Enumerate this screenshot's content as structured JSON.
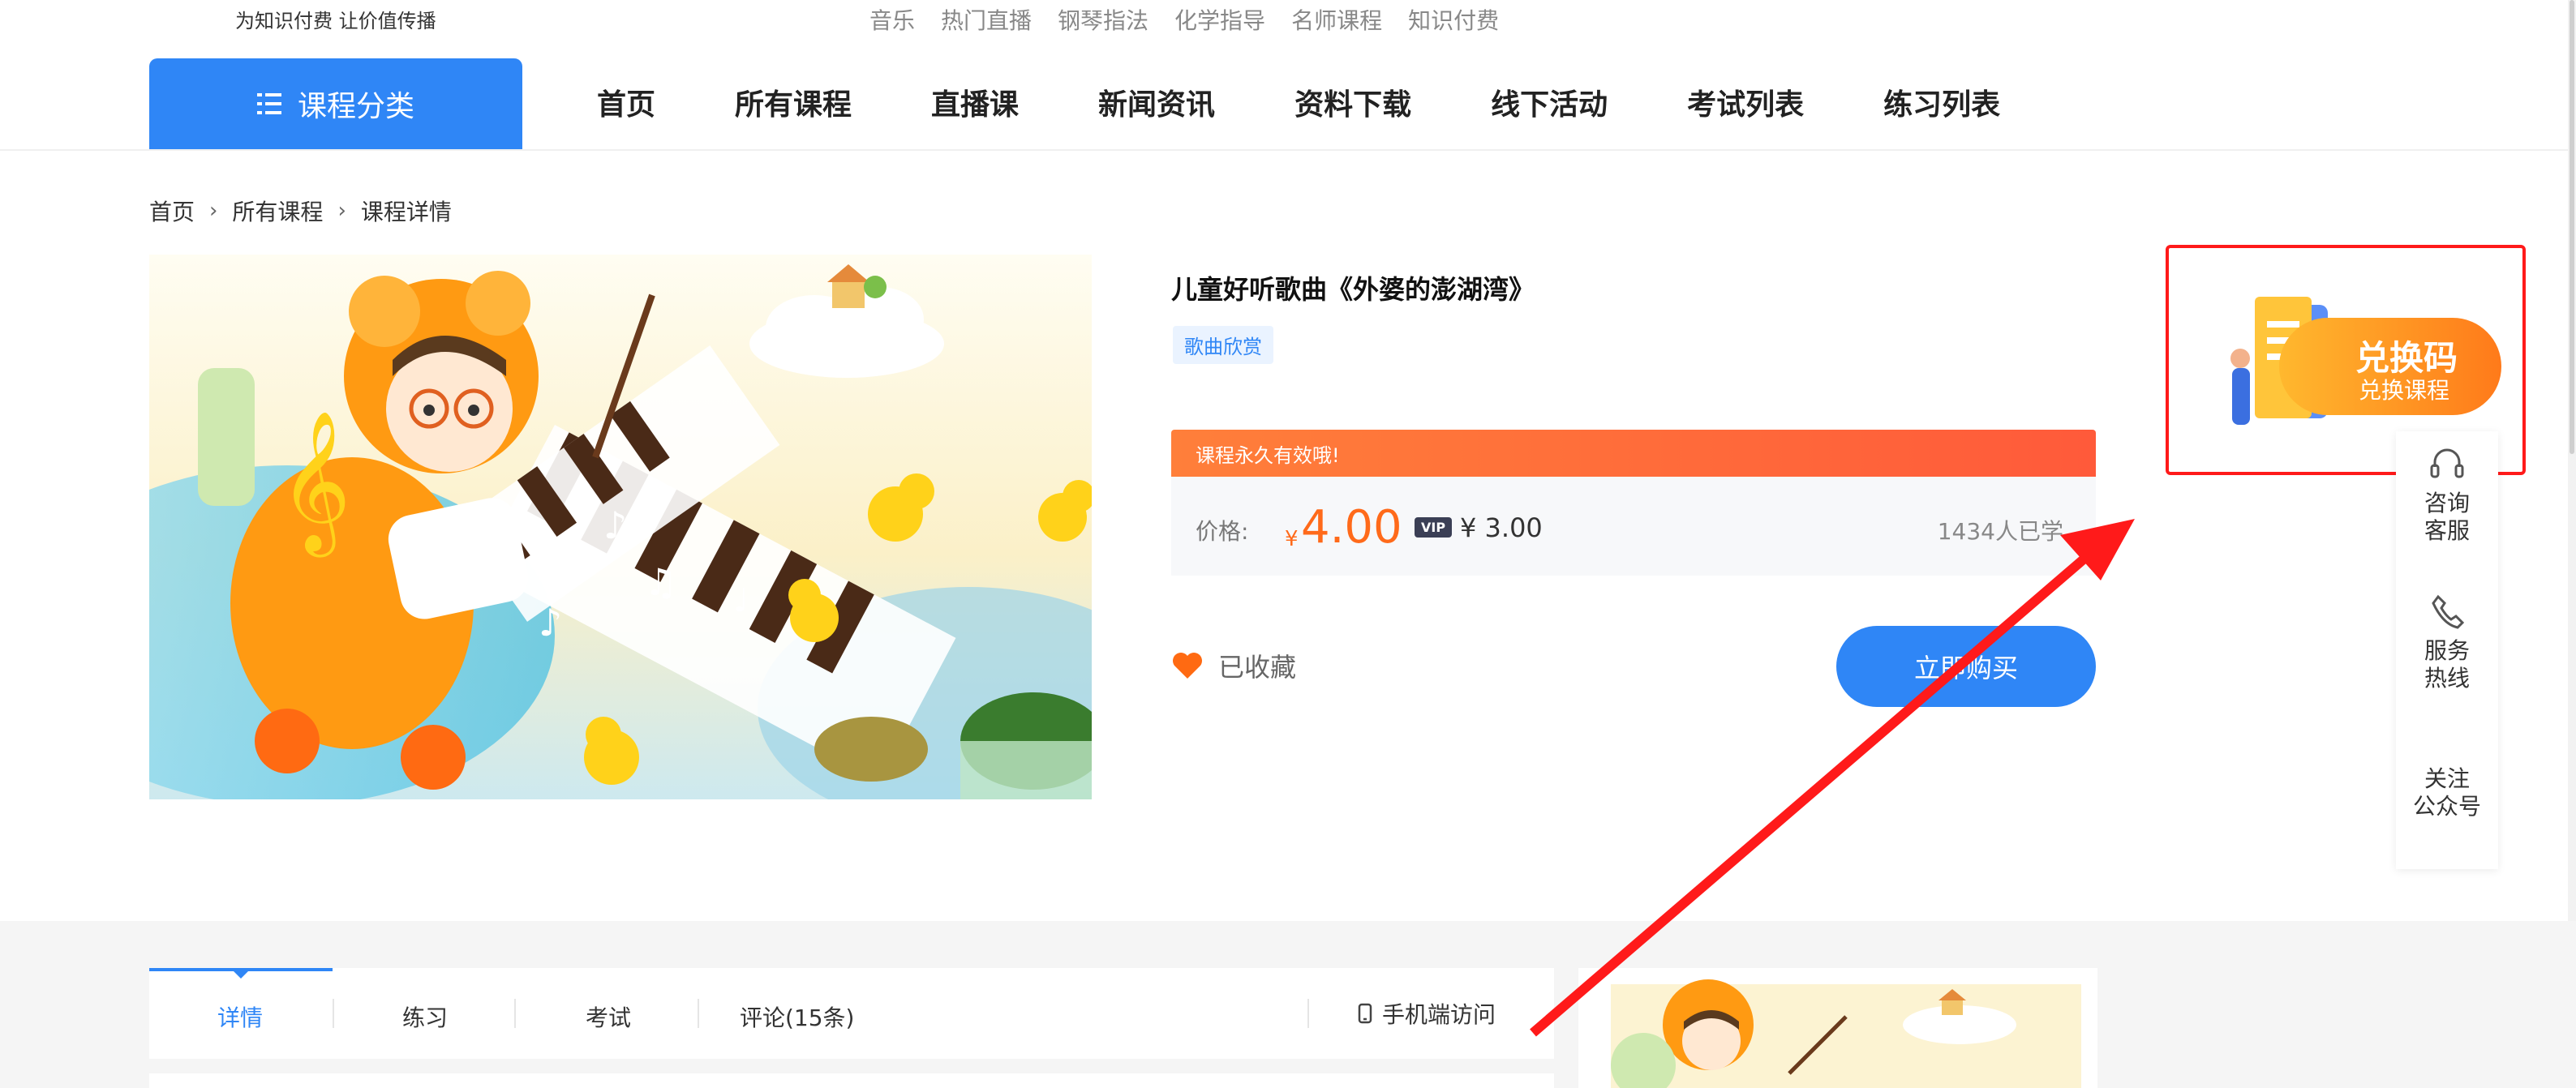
{
  "top": {
    "slogan": "为知识付费 让价值传播",
    "hotwords": [
      "音乐",
      "热门直播",
      "钢琴指法",
      "化学指导",
      "名师课程",
      "知识付费"
    ]
  },
  "nav": {
    "category_label": "课程分类",
    "items": [
      "首页",
      "所有课程",
      "直播课",
      "新闻资讯",
      "资料下载",
      "线下活动",
      "考试列表",
      "练习列表"
    ]
  },
  "breadcrumb": [
    "首页",
    "所有课程",
    "课程详情"
  ],
  "course": {
    "title": "儿童好听歌曲《外婆的澎湖湾》",
    "tag": "歌曲欣赏",
    "promo": "课程永久有效哦!",
    "price_label": "价格:",
    "currency": "¥",
    "price": "4.00",
    "vip_badge": "VIP",
    "vip_price": "¥ 3.00",
    "learned": "1434人已学",
    "favorite": "已收藏",
    "buy_button": "立即购买"
  },
  "redeem": {
    "title": "兑换码",
    "subtitle": "兑换课程"
  },
  "sidebar": {
    "items": [
      {
        "line1": "咨询",
        "line2": "客服",
        "icon": "headset-icon"
      },
      {
        "line1": "服务",
        "line2": "热线",
        "icon": "phone-icon"
      },
      {
        "line1": "关注",
        "line2": "公众号",
        "icon": ""
      }
    ]
  },
  "tabs": {
    "items": [
      "详情",
      "练习",
      "考试",
      "评论(15条)"
    ],
    "mobile": "手机端访问"
  },
  "colors": {
    "primary": "#2f86f6",
    "price": "#ff6a1a",
    "annotation": "#ff1a1a"
  }
}
